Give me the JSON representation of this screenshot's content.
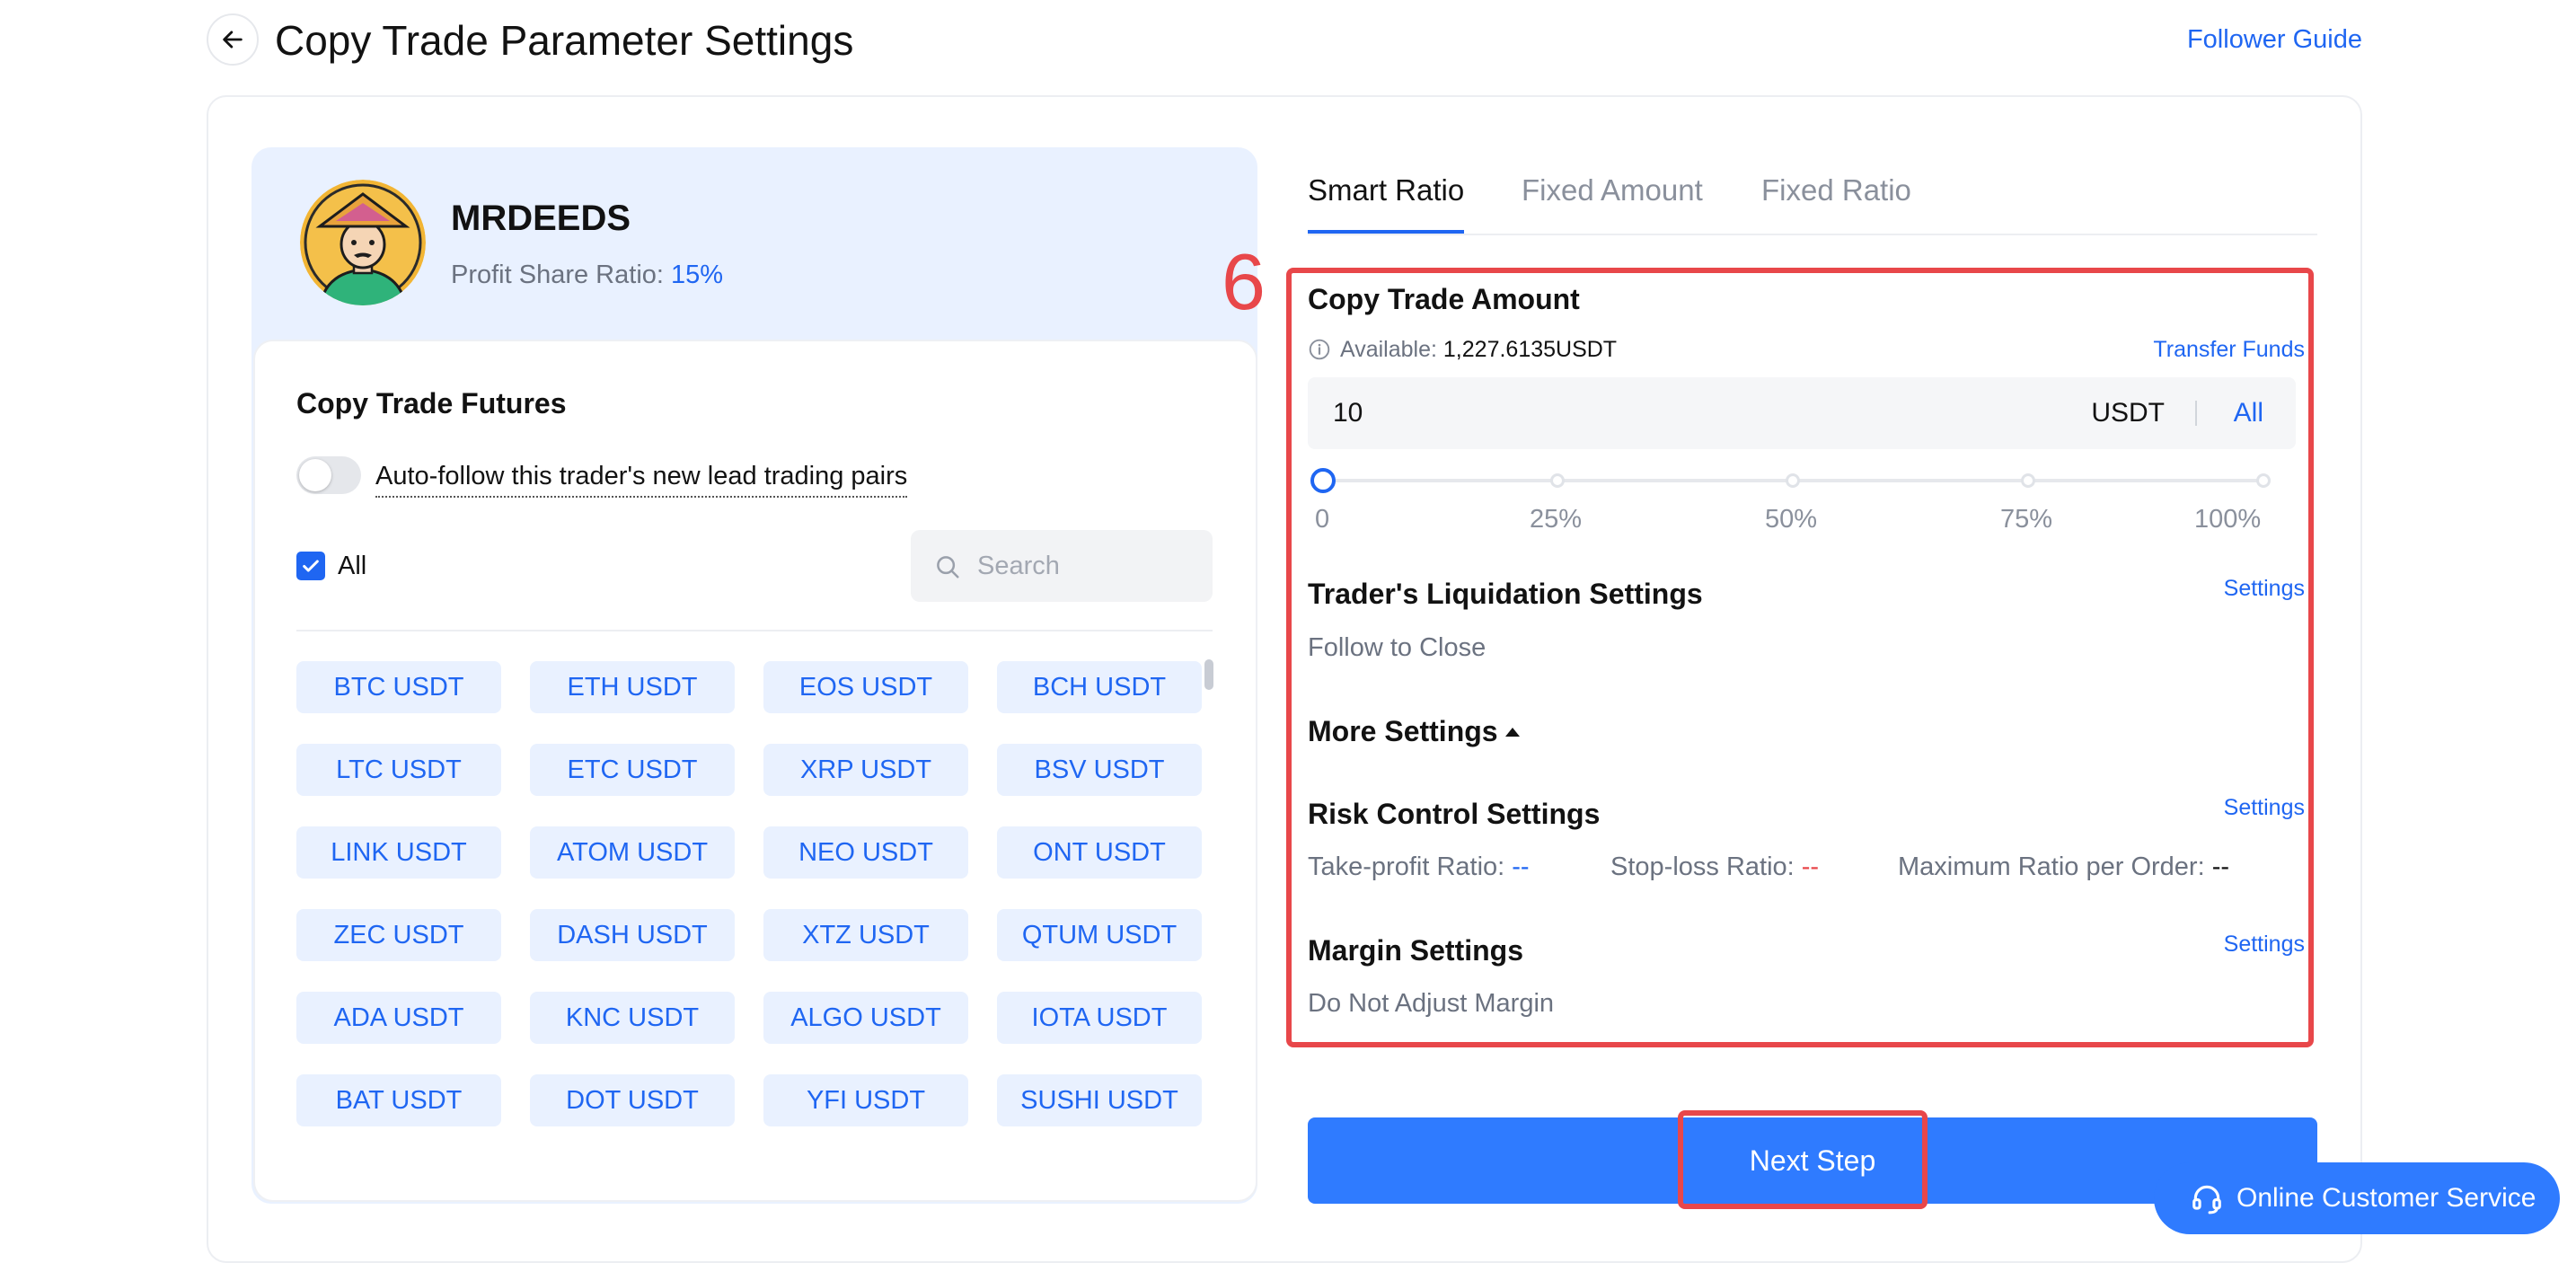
{
  "header": {
    "title": "Copy Trade Parameter Settings",
    "follower_guide": "Follower Guide"
  },
  "trader": {
    "name": "MRDEEDS",
    "profit_share_label": "Profit Share Ratio:",
    "profit_share_value": "15%"
  },
  "futures": {
    "title": "Copy Trade Futures",
    "auto_follow_label": "Auto-follow this trader's new lead trading pairs",
    "auto_follow_on": false,
    "all_label": "All",
    "all_checked": true,
    "search_placeholder": "Search",
    "pairs": [
      "BTC USDT",
      "ETH USDT",
      "EOS USDT",
      "BCH USDT",
      "LTC USDT",
      "ETC USDT",
      "XRP USDT",
      "BSV USDT",
      "LINK USDT",
      "ATOM USDT",
      "NEO USDT",
      "ONT USDT",
      "ZEC USDT",
      "DASH USDT",
      "XTZ USDT",
      "QTUM USDT",
      "ADA USDT",
      "KNC USDT",
      "ALGO USDT",
      "IOTA USDT",
      "BAT USDT",
      "DOT USDT",
      "YFI USDT",
      "SUSHI USDT"
    ]
  },
  "tabs": {
    "items": [
      "Smart Ratio",
      "Fixed Amount",
      "Fixed Ratio"
    ],
    "active_index": 0
  },
  "annotation": {
    "step_number": "6",
    "color": "#e8474a"
  },
  "amount": {
    "title": "Copy Trade Amount",
    "available_label": "Available:",
    "available_value": "1,227.6135USDT",
    "transfer_funds": "Transfer Funds",
    "value": "10",
    "unit": "USDT",
    "all_button": "All",
    "slider_marks": [
      "0",
      "25%",
      "50%",
      "75%",
      "100%"
    ],
    "slider_value_percent": 0
  },
  "liquidation": {
    "title": "Trader's Liquidation Settings",
    "settings_link": "Settings",
    "value": "Follow to Close"
  },
  "more_settings": {
    "label": "More Settings"
  },
  "risk_control": {
    "title": "Risk Control Settings",
    "settings_link": "Settings",
    "take_profit_label": "Take-profit Ratio:",
    "take_profit_value": "--",
    "stop_loss_label": "Stop-loss Ratio:",
    "stop_loss_value": "--",
    "max_ratio_label": "Maximum Ratio per Order:",
    "max_ratio_value": "--"
  },
  "margin": {
    "title": "Margin Settings",
    "settings_link": "Settings",
    "value": "Do Not Adjust Margin"
  },
  "actions": {
    "next_step": "Next Step",
    "support": "Online Customer Service"
  },
  "colors": {
    "accent": "#1f66f2",
    "button": "#2f7bff",
    "highlight": "#e8474a",
    "panel": "#e9f1ff"
  }
}
